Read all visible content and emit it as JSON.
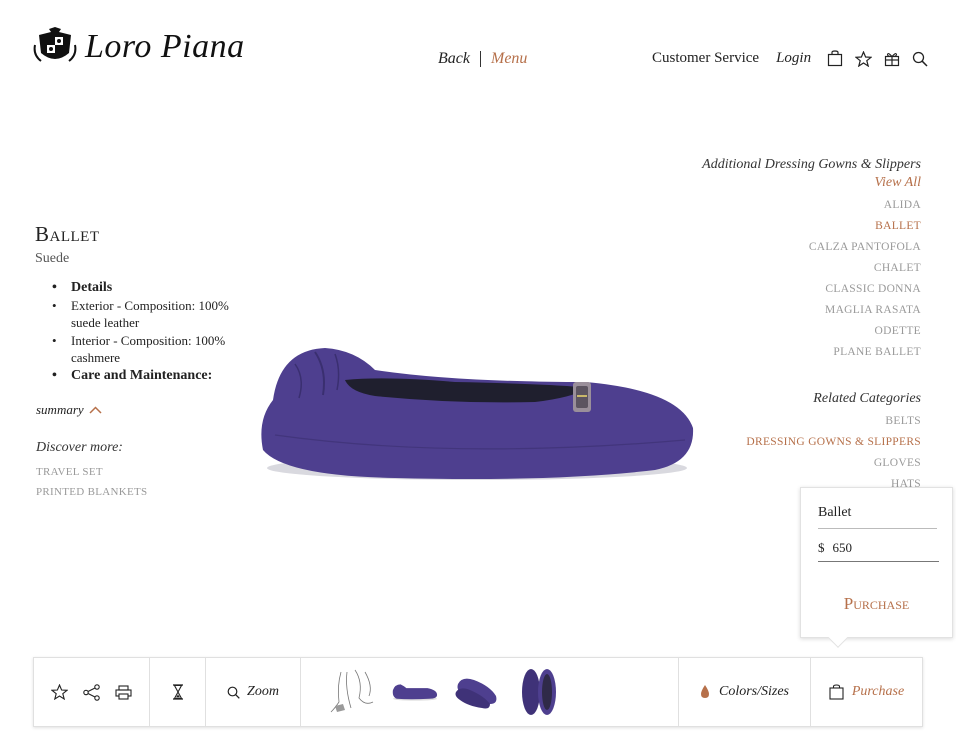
{
  "header": {
    "brand": "Loro Piana",
    "nav": {
      "back": "Back",
      "menu": "Menu"
    },
    "links": {
      "customer_service": "Customer Service",
      "login": "Login"
    },
    "icons": [
      "bag-icon",
      "star-icon",
      "gift-icon",
      "search-icon"
    ]
  },
  "product": {
    "title": "Ballet",
    "subtitle": "Suede",
    "details": [
      {
        "text": "Details",
        "bold": true
      },
      {
        "text": "Exterior - Composition: 100% suede leather",
        "bold": false
      },
      {
        "text": "Interior - Composition: 100% cashmere",
        "bold": false
      },
      {
        "text": "Care and Maintenance:",
        "bold": true
      }
    ],
    "summary_label": "summary",
    "discover_label": "Discover more:",
    "discover_links": [
      "TRAVEL SET",
      "PRINTED BLANKETS"
    ]
  },
  "additional": {
    "heading": "Additional Dressing Gowns & Slippers",
    "view_all": "View All",
    "items": [
      {
        "label": "ALIDA",
        "active": false
      },
      {
        "label": "BALLET",
        "active": true
      },
      {
        "label": "CALZA PANTOFOLA",
        "active": false
      },
      {
        "label": "CHALET",
        "active": false
      },
      {
        "label": "CLASSIC DONNA",
        "active": false
      },
      {
        "label": "MAGLIA RASATA",
        "active": false
      },
      {
        "label": "ODETTE",
        "active": false
      },
      {
        "label": "PLANE BALLET",
        "active": false
      }
    ]
  },
  "related": {
    "heading": "Related Categories",
    "items": [
      {
        "label": "BELTS",
        "active": false
      },
      {
        "label": "DRESSING GOWNS & SLIPPERS",
        "active": true
      },
      {
        "label": "GLOVES",
        "active": false
      },
      {
        "label": "HATS",
        "active": false
      }
    ]
  },
  "purchase_popup": {
    "product_name": "Ballet",
    "currency": "$",
    "price": "650",
    "purchase_label": "Purchase"
  },
  "toolbar": {
    "zoom_label": "Zoom",
    "colors_label": "Colors/Sizes",
    "purchase_label": "Purchase"
  },
  "colors": {
    "accent": "#b6704a",
    "shoe": "#4e3f8f",
    "muted_text": "#999999"
  }
}
